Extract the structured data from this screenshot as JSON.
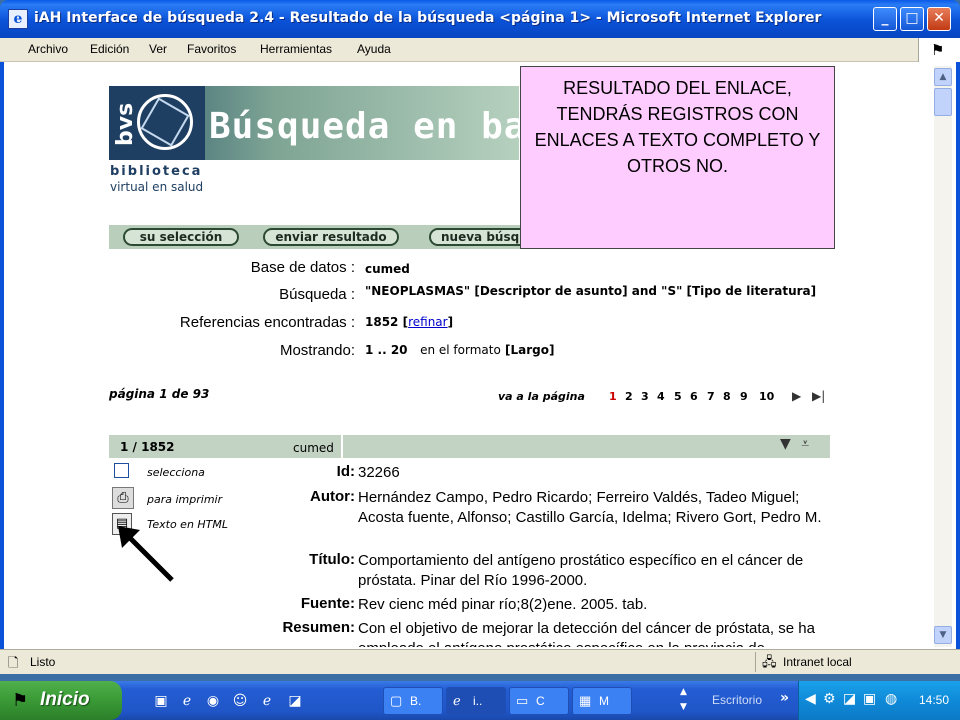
{
  "window": {
    "title": "iAH Interface de búsqueda 2.4 - Resultado de la búsqueda <página 1> - Microsoft Internet Explorer",
    "minimize": "_",
    "maximize": "□",
    "close": "✕"
  },
  "menu": [
    "Archivo",
    "Edición",
    "Ver",
    "Favoritos",
    "Herramientas",
    "Ayuda"
  ],
  "banner": {
    "logo_text": "bvs",
    "headline": "Búsqueda en bases",
    "subtitle1": "biblioteca",
    "subtitle2": "virtual en salud"
  },
  "callout": "RESULTADO DEL ENLACE, TENDRÁS REGISTROS CON ENLACES A TEXTO COMPLETO Y OTROS NO.",
  "nav_buttons": [
    "su selección",
    "enviar resultado",
    "nueva búsqueda"
  ],
  "search_info": {
    "db_label": "Base de datos :",
    "db_value": "cumed",
    "query_label": "Búsqueda :",
    "query_value": "\"NEOPLASMAS\" [Descriptor de asunto] and \"S\" [Tipo de literatura]",
    "refs_label": "Referencias encontradas :",
    "refs_value": "1852",
    "refs_link": "refinar",
    "showing_label": "Mostrando:",
    "showing_range": "1 .. 20",
    "showing_format_prefix": "en el formato",
    "showing_format": "Largo"
  },
  "pagination": {
    "page_label": "página 1 de 93",
    "goto_label": "va a la página",
    "pages": [
      "1",
      "2",
      "3",
      "4",
      "5",
      "6",
      "7",
      "8",
      "9",
      "10"
    ],
    "current": "1"
  },
  "record": {
    "count": "1 / 1852",
    "db": "cumed",
    "actions": {
      "select": "selecciona",
      "print": "para imprimir",
      "html": "Texto en HTML"
    },
    "id_label": "Id:",
    "id_value": "32266",
    "author_label": "Autor:",
    "author_value": "Hernández Campo, Pedro Ricardo; Ferreiro Valdés, Tadeo Miguel; Acosta fuente, Alfonso; Castillo García, Idelma; Rivero Gort, Pedro M.",
    "title_label": "Título:",
    "title_value": "Comportamiento del antígeno prostático específico en el cáncer de próstata. Pinar del Río 1996-2000.",
    "source_label": "Fuente:",
    "source_value": "Rev cienc méd pinar río;8(2)ene. 2005. tab.",
    "abstract_label": "Resumen:",
    "abstract_value": "Con el objetivo de mejorar la detección del cáncer de próstata, se ha empleado el antígeno prostático específico en la provincia de"
  },
  "status": {
    "text": "Listo",
    "zone": "Intranet local"
  },
  "taskbar": {
    "start": "Inicio",
    "tasks": [
      "B.",
      "i..",
      "C",
      "M"
    ],
    "desktop": "Escritorio",
    "clock": "14:50"
  },
  "colors": {
    "xp_blue": "#0a52d8",
    "callout_bg": "#ffccff",
    "nav_green": "#b9cfbb",
    "current_page": "#cc0000"
  }
}
